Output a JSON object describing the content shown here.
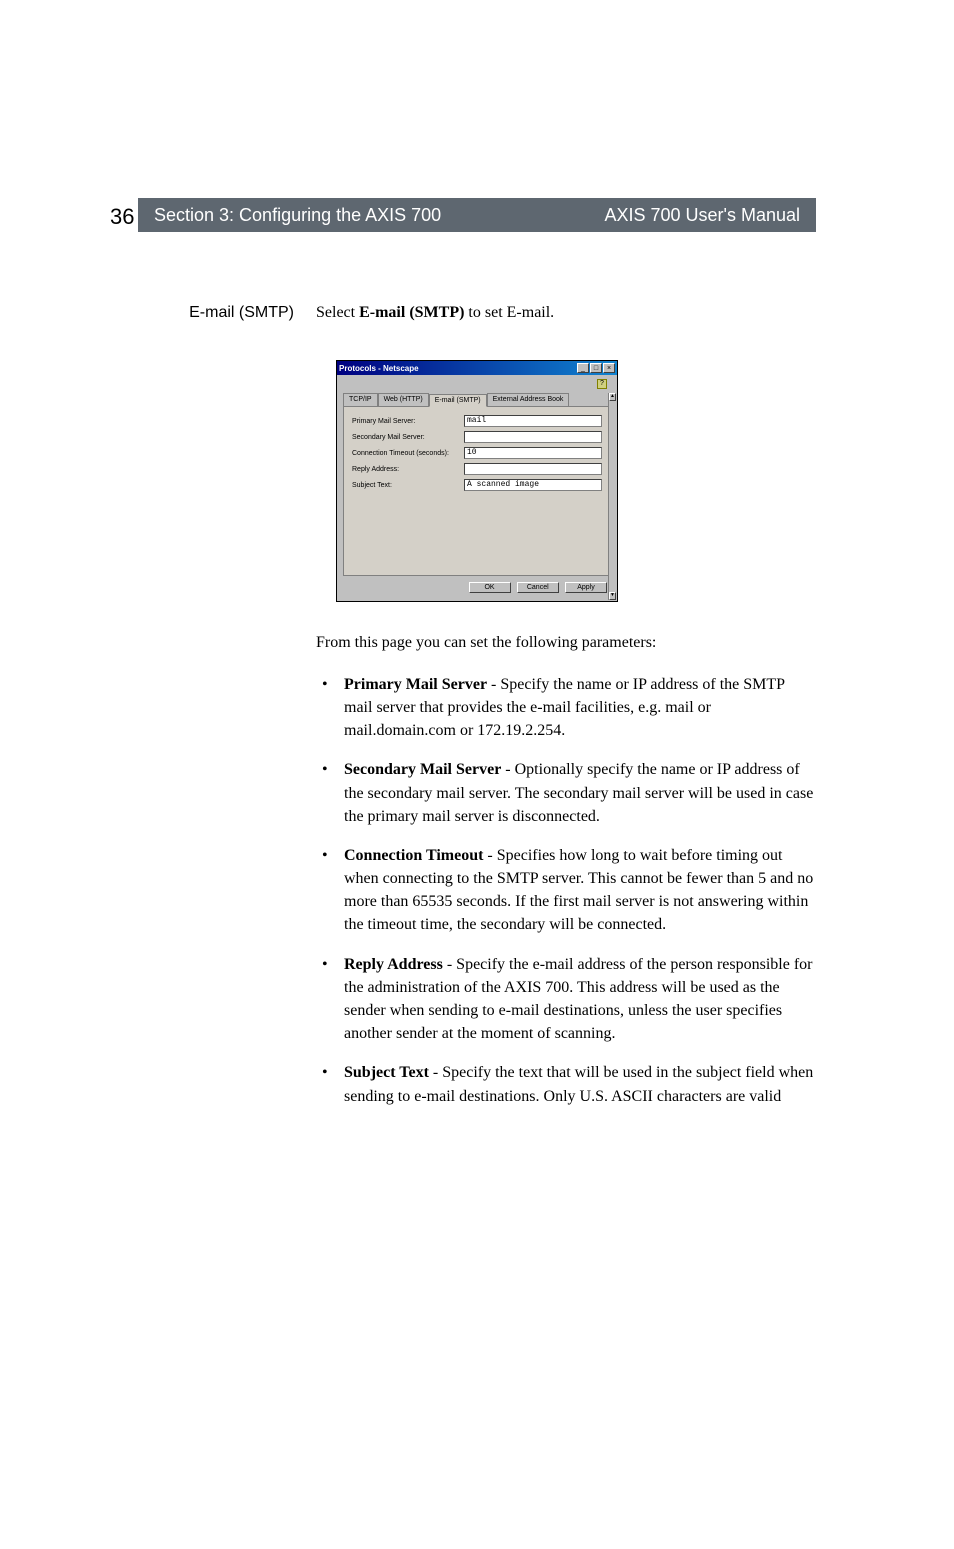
{
  "header": {
    "page_number": "36",
    "section_title": "Section 3: Configuring the AXIS 700",
    "manual_title": "AXIS 700 User's Manual"
  },
  "section": {
    "side_label": "E-mail (SMTP)",
    "intro_prefix": "Select ",
    "intro_bold": "E-mail (SMTP)",
    "intro_suffix": " to set E-mail."
  },
  "screenshot": {
    "title": "Protocols - Netscape",
    "minimize": "_",
    "maximize": "□",
    "close": "×",
    "help": "?",
    "tabs": {
      "tcpip": "TCP/IP",
      "web": "Web (HTTP)",
      "email": "E-mail (SMTP)",
      "external": "External Address Book"
    },
    "fields": {
      "primary_label": "Primary Mail Server:",
      "primary_value": "mail",
      "secondary_label": "Secondary Mail Server:",
      "secondary_value": "",
      "timeout_label": "Connection Timeout (seconds):",
      "timeout_value": "10",
      "reply_label": "Reply Address:",
      "reply_value": "",
      "subject_label": "Subject Text:",
      "subject_value": "A scanned image"
    },
    "buttons": {
      "ok": "OK",
      "cancel": "Cancel",
      "apply": "Apply"
    }
  },
  "after_para": "From this page you can set the following parameters:",
  "bullets": {
    "b1_bold": "Primary Mail Server",
    "b1_text": " - Specify the name or IP address of the SMTP mail server that provides the e-mail facilities, e.g. mail or mail.domain.com or 172.19.2.254.",
    "b2_bold": "Secondary Mail Server",
    "b2_text": " - Optionally specify the name or IP address of the secondary mail server. The secondary mail server will be used in case the primary mail server is disconnected.",
    "b3_bold": "Connection Timeout",
    "b3_text": " - Specifies how long to wait before timing out when connecting to the SMTP server. This cannot be fewer than 5 and no more than 65535 seconds. If the first mail server is not answering within the timeout time, the secondary will be connected.",
    "b4_bold": "Reply Address",
    "b4_text": " - Specify the e-mail address of the person responsible for the administration of the AXIS 700. This address will be used as the sender when sending to e-mail destinations, unless the user specifies another sender at the moment of scanning.",
    "b5_bold": "Subject Text",
    "b5_text": " - Specify the text that will be used in the subject field when sending to e-mail destinations. Only U.S. ASCII characters are valid"
  }
}
